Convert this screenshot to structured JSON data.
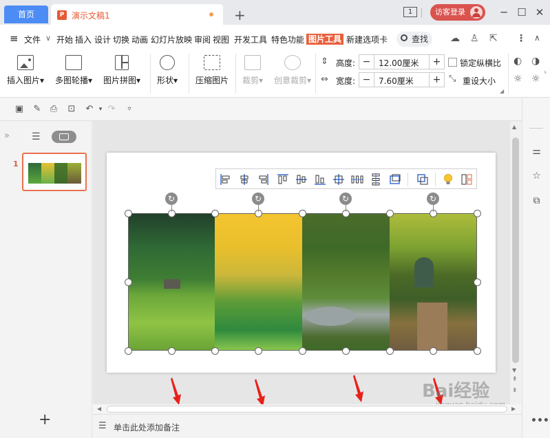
{
  "titlebar": {
    "home_tab": "首页",
    "doc_tab": "演示文稿1",
    "doc_icon_letter": "P",
    "new_tab": "+",
    "window_count": "1",
    "login": "访客登录"
  },
  "menu": {
    "file": "文件",
    "items": [
      "开始",
      "插入",
      "设计",
      "切换",
      "动画",
      "幻灯片放映",
      "审阅",
      "视图",
      "开发工具",
      "特色功能"
    ],
    "active": "图片工具",
    "new_tab": "新建选项卡",
    "search": "查找"
  },
  "ribbon": {
    "insert_picture": "插入图片",
    "multi_carousel": "多图轮播",
    "picture_collage": "图片拼图",
    "shape": "形状",
    "compress": "压缩图片",
    "crop": "裁剪",
    "creative_crop": "创意裁剪",
    "height_label": "高度:",
    "height_value": "12.00厘米",
    "width_label": "宽度:",
    "width_value": "7.60厘米",
    "lock_ratio": "锁定纵横比",
    "reset_size": "重设大小"
  },
  "left_panel": {
    "slide_number": "1"
  },
  "notes": {
    "placeholder": "单击此处添加备注"
  },
  "watermark": {
    "brand": "Bai经验",
    "url": "jingyan.baidu.com"
  },
  "colors": {
    "accent": "#e8603c",
    "tab_blue": "#4d8cf5",
    "arrow_red": "#e8201a",
    "login_red": "#d9534f"
  }
}
